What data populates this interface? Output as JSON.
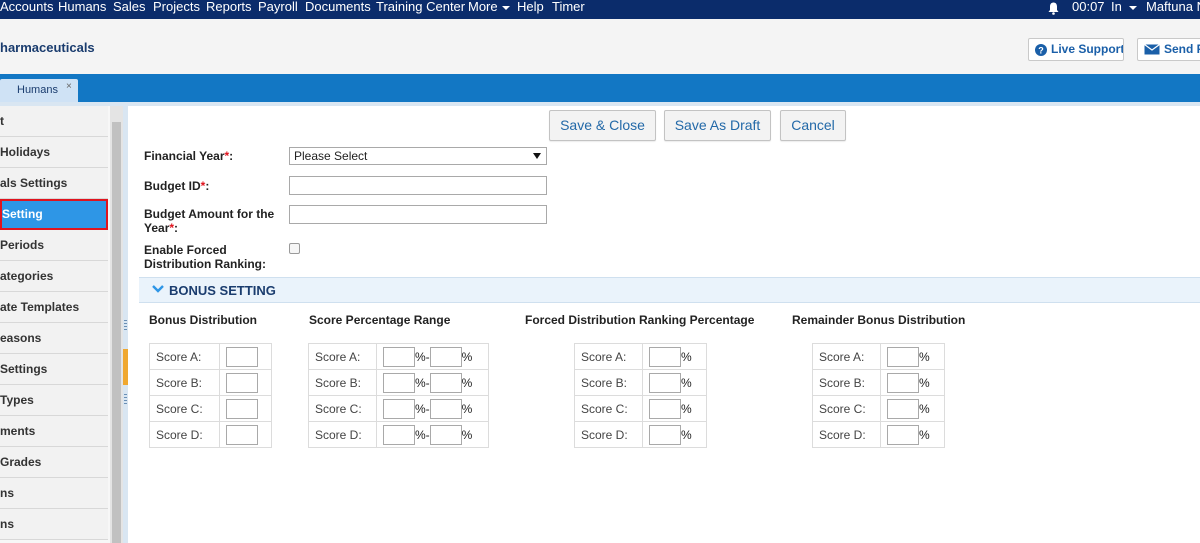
{
  "nav": {
    "items": [
      "Accounts",
      "Humans",
      "Sales",
      "Projects",
      "Reports",
      "Payroll",
      "Documents",
      "Training Center",
      "More",
      "Help",
      "Timer"
    ],
    "clock": "00:07",
    "status": "In",
    "user": "Maftuna N"
  },
  "header": {
    "company": "harmaceuticals",
    "live_support": "Live Support",
    "send": "Send F"
  },
  "tabs": [
    {
      "label": "Humans",
      "close": "×"
    }
  ],
  "sidebar": {
    "items": [
      {
        "label": "t"
      },
      {
        "label": "Holidays"
      },
      {
        "label": "als Settings"
      },
      {
        "label": "Setting"
      },
      {
        "label": "Periods"
      },
      {
        "label": "ategories"
      },
      {
        "label": "ate Templates"
      },
      {
        "label": "easons"
      },
      {
        "label": "Settings"
      },
      {
        "label": "Types"
      },
      {
        "label": "ments"
      },
      {
        "label": "Grades"
      },
      {
        "label": "ns"
      },
      {
        "label": "ns"
      }
    ],
    "active_index": 3
  },
  "toolbar": {
    "save_close": "Save & Close",
    "save_draft": "Save As Draft",
    "cancel": "Cancel"
  },
  "form": {
    "financial_year_label": "Financial Year",
    "financial_year_value": "Please Select",
    "budget_id_label": "Budget ID",
    "budget_amount_label_1": "Budget Amount for the",
    "budget_amount_label_2": "Year",
    "forced_label_1": "Enable Forced",
    "forced_label_2": "Distribution Ranking:",
    "required_mark": "*",
    "colon": ":"
  },
  "bonus": {
    "section_title": "BONUS SETTING",
    "col_distribution": "Bonus Distribution",
    "col_percentage_range": "Score Percentage Range",
    "col_forced_percentage": "Forced Distribution Ranking Percentage",
    "col_remainder": "Remainder Bonus Distribution",
    "scores": [
      "Score A:",
      "Score B:",
      "Score C:",
      "Score D:"
    ],
    "percent": "%",
    "range_sep": "%-"
  },
  "colors": {
    "nav_bg": "#0b2c6b",
    "tabbar_bg": "#1277c4",
    "active_item_bg": "#2e96e6",
    "highlight_border": "#e0141e",
    "button_text": "#2369a8"
  }
}
